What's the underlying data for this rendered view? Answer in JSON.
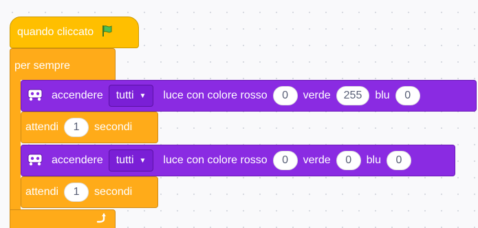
{
  "event": {
    "label": "quando cliccato",
    "flag_icon": "green-flag-icon"
  },
  "forever": {
    "label": "per sempre",
    "loop_icon": "loop-arrow-icon"
  },
  "light_blocks": [
    {
      "label": "accendere",
      "target": "tutti",
      "text_light": "luce con colore rosso",
      "red": "0",
      "text_green": "verde",
      "green": "255",
      "text_blue": "blu",
      "blue": "0"
    },
    {
      "label": "accendere",
      "target": "tutti",
      "text_light": "luce con colore rosso",
      "red": "0",
      "text_green": "verde",
      "green": "0",
      "text_blue": "blu",
      "blue": "0"
    }
  ],
  "wait_blocks": [
    {
      "label": "attendi",
      "value": "1",
      "unit": "secondi"
    },
    {
      "label": "attendi",
      "value": "1",
      "unit": "secondi"
    }
  ],
  "colors": {
    "event": "#ffbf00",
    "control": "#ffab19",
    "extension": "#8a2be2",
    "workspace": "#f9f9fb"
  }
}
